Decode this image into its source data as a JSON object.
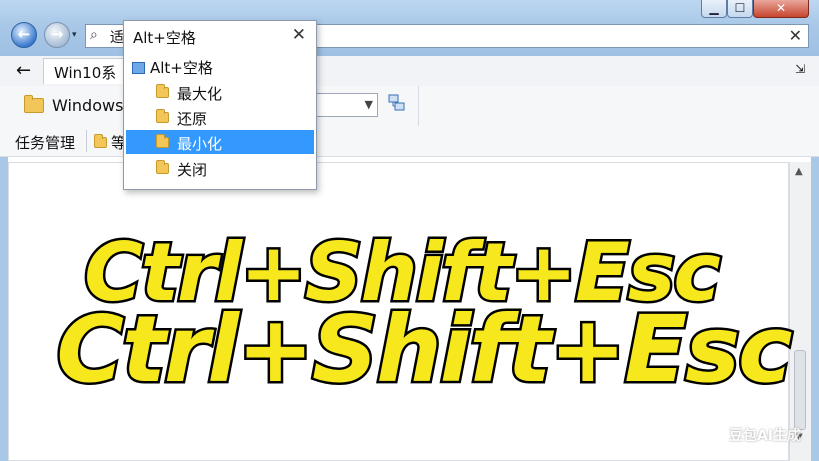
{
  "window": {
    "min_glyph": "▁",
    "max_glyph": "☐",
    "close_glyph": "✕"
  },
  "nav": {
    "back_glyph": "←",
    "forward_glyph": "→",
    "dropdown_glyph": "▾"
  },
  "address": {
    "value": "适",
    "clear_glyph": "✕",
    "search_glyph": "⌕"
  },
  "tabs": {
    "back_glyph": "←",
    "active_label": "Win10系统",
    "menu_glyph": "⇲"
  },
  "toolbar": {
    "bookmark_label": "Windows",
    "select_chevron": "▼"
  },
  "tasks": {
    "task_manager_label": "任务管理",
    "folder_label": "等"
  },
  "overlay": {
    "line1": "Ctrl+Shift+Esc",
    "line2": "Ctrl+Shift+Esc"
  },
  "popup": {
    "title": "Alt+空格",
    "close_glyph": "✕",
    "root_label": "Alt+空格",
    "items": [
      {
        "label": "最大化",
        "selected": false
      },
      {
        "label": "还原",
        "selected": false
      },
      {
        "label": "最小化",
        "selected": true
      },
      {
        "label": "关闭",
        "selected": false
      }
    ]
  },
  "scroll": {
    "up_glyph": "▲",
    "down_glyph": "▼"
  },
  "watermark": "豆包AI生成",
  "colors": {
    "selection": "#3399ff",
    "overlay_text": "#f6e81c",
    "titlebar": "#a9c8e8"
  }
}
